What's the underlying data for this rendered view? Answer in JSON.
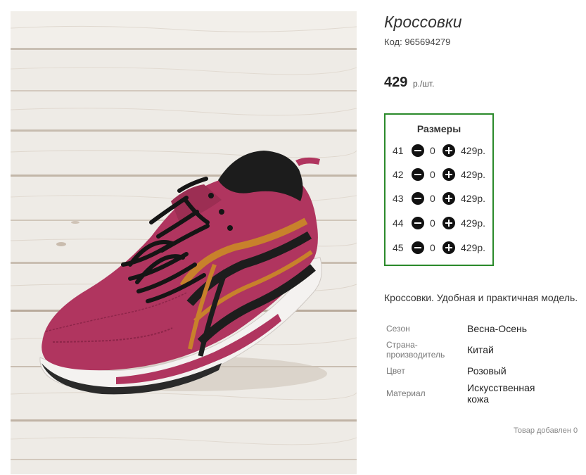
{
  "product": {
    "title": "Кроссовки",
    "code_label": "Код: 965694279",
    "price_value": "429",
    "price_unit": "р./шт."
  },
  "sizes": {
    "title": "Размеры",
    "rows": [
      {
        "size": "41",
        "qty": "0",
        "price": "429р."
      },
      {
        "size": "42",
        "qty": "0",
        "price": "429р."
      },
      {
        "size": "43",
        "qty": "0",
        "price": "429р."
      },
      {
        "size": "44",
        "qty": "0",
        "price": "429р."
      },
      {
        "size": "45",
        "qty": "0",
        "price": "429р."
      }
    ]
  },
  "description": "Кроссовки. Удобная и практичная модель.",
  "properties": [
    {
      "label": "Сезон",
      "value": "Весна-Осень"
    },
    {
      "label": "Страна-производитель",
      "value": "Китай"
    },
    {
      "label": "Цвет",
      "value": "Розовый"
    },
    {
      "label": "Материал",
      "value": "Искусственная кожа"
    }
  ],
  "added_note": "Товар добавлен 0",
  "colors": {
    "sizes_border": "#2b8a2b",
    "shoe_main": "#b0355f",
    "wood_background": "#ece9e4"
  },
  "icons": {
    "minus": "minus-circle-icon",
    "plus": "plus-circle-icon"
  }
}
